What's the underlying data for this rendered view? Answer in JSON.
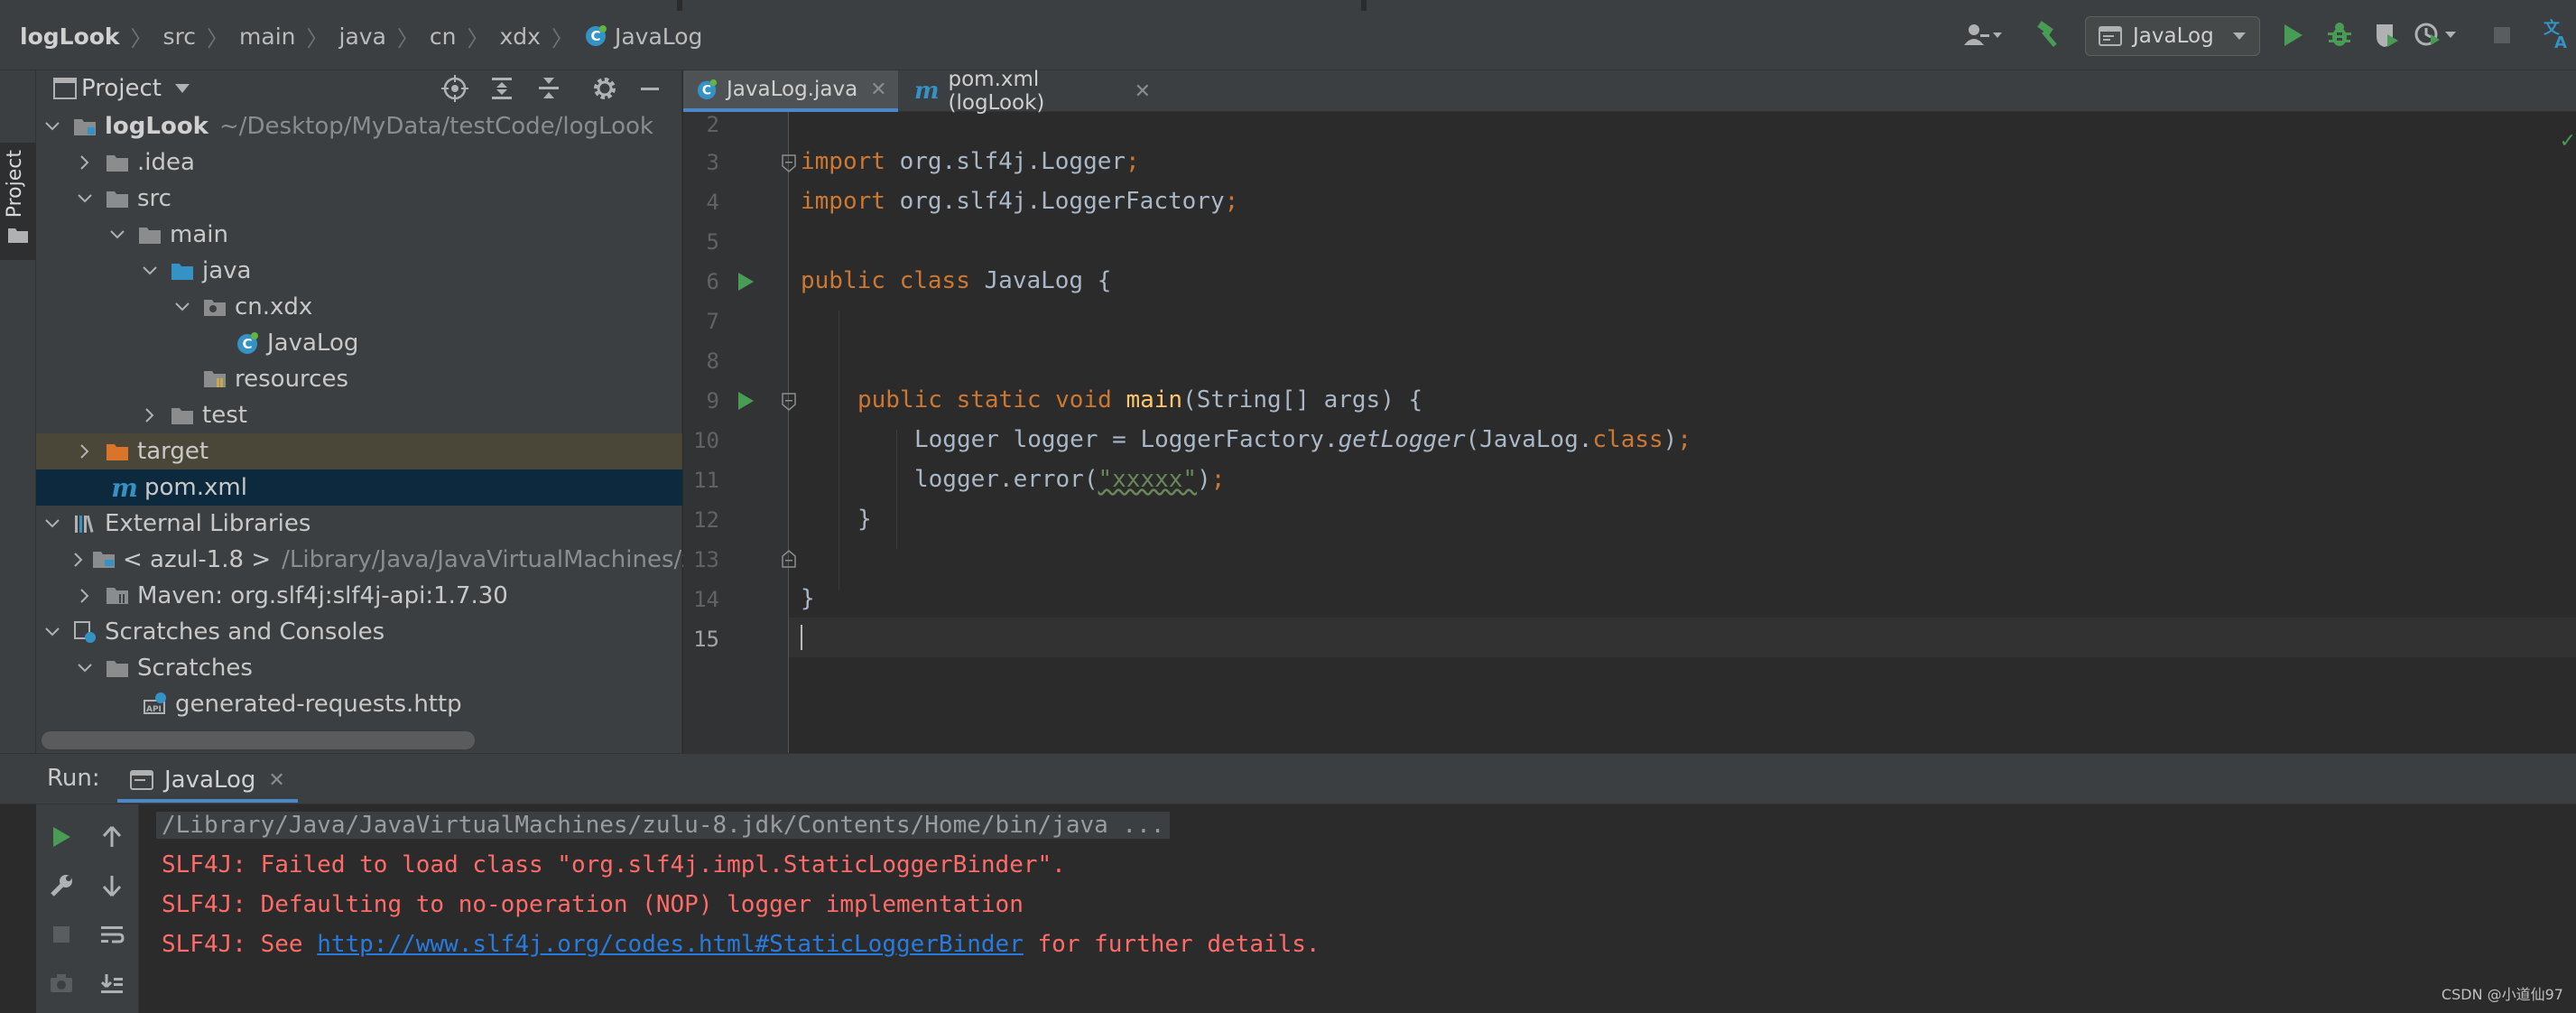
{
  "breadcrumb": [
    "logLook",
    "src",
    "main",
    "java",
    "cn",
    "xdx",
    "JavaLog"
  ],
  "toolbar": {
    "run_config": "JavaLog",
    "icons": [
      "user-icon",
      "hammer-icon",
      "run-icon",
      "debug-icon",
      "coverage-icon",
      "profile-icon",
      "stop-icon",
      "translate-icon"
    ]
  },
  "left_stripe": {
    "project_label": "Project"
  },
  "project_panel": {
    "title": "Project",
    "tree": [
      {
        "label": "logLook",
        "path": "~/Desktop/MyData/testCode/logLook",
        "icon": "module-folder-icon"
      },
      {
        "label": ".idea",
        "icon": "folder-icon"
      },
      {
        "label": "src",
        "icon": "folder-icon"
      },
      {
        "label": "main",
        "icon": "folder-icon"
      },
      {
        "label": "java",
        "icon": "source-folder-icon"
      },
      {
        "label": "cn.xdx",
        "icon": "package-icon"
      },
      {
        "label": "JavaLog",
        "icon": "java-class-icon"
      },
      {
        "label": "resources",
        "icon": "resources-folder-icon"
      },
      {
        "label": "test",
        "icon": "folder-icon"
      },
      {
        "label": "target",
        "icon": "excluded-folder-icon"
      },
      {
        "label": "pom.xml",
        "icon": "maven-icon"
      },
      {
        "label": "External Libraries",
        "icon": "library-icon"
      },
      {
        "label": "< azul-1.8 >",
        "path": "/Library/Java/JavaVirtualMachines/z",
        "icon": "jdk-icon"
      },
      {
        "label": "Maven: org.slf4j:slf4j-api:1.7.30",
        "icon": "jar-icon"
      },
      {
        "label": "Scratches and Consoles",
        "icon": "scratches-icon"
      },
      {
        "label": "Scratches",
        "icon": "folder-icon"
      },
      {
        "label": "generated-requests.http",
        "icon": "api-file-icon"
      }
    ]
  },
  "editor": {
    "tabs": [
      {
        "label": "JavaLog.java",
        "active": true
      },
      {
        "label": "pom.xml (logLook)",
        "active": false
      }
    ],
    "line_numbers": [
      "2",
      "3",
      "4",
      "5",
      "6",
      "7",
      "8",
      "9",
      "10",
      "11",
      "12",
      "13",
      "14",
      "15"
    ],
    "code": {
      "l3": {
        "kw": "import",
        "rest": " org.slf4j.Logger",
        "semi": ";"
      },
      "l4": {
        "kw": "import",
        "rest": " org.slf4j.LoggerFactory",
        "semi": ";"
      },
      "l6": {
        "kw1": "public",
        "kw2": "class",
        "rest": " JavaLog {"
      },
      "l9": {
        "kw1": "public",
        "kw2": "static",
        "kw3": "void",
        "fn": "main",
        "rest": "(String[] args) {"
      },
      "l10": {
        "a": "Logger logger = LoggerFactory.",
        "it": "getLogger",
        "b": "(JavaLog.",
        "kw": "class",
        "c": ")",
        "semi": ";"
      },
      "l11": {
        "a": "logger.error(",
        "str": "\"xxxxx\"",
        "b": ")",
        "semi": ";"
      },
      "l12": "}",
      "l14": "}"
    }
  },
  "run_panel": {
    "label": "Run:",
    "tab": "JavaLog",
    "console": {
      "command": "/Library/Java/JavaVirtualMachines/zulu-8.jdk/Contents/Home/bin/java ...",
      "err1": "SLF4J: Failed to load class \"org.slf4j.impl.StaticLoggerBinder\".",
      "err2": "SLF4J: Defaulting to no-operation (NOP) logger implementation",
      "err3_prefix": "SLF4J: See ",
      "err3_link": "http://www.slf4j.org/codes.html#StaticLoggerBinder",
      "err3_suffix": " for further details."
    }
  },
  "watermark": "CSDN @小道仙97",
  "colors": {
    "keyword": "#cc7832",
    "function": "#ffc66d",
    "string": "#6a8759",
    "error": "#ff6b68",
    "link": "#287bde",
    "accent": "#4a88c7",
    "run_green": "#499c54"
  }
}
